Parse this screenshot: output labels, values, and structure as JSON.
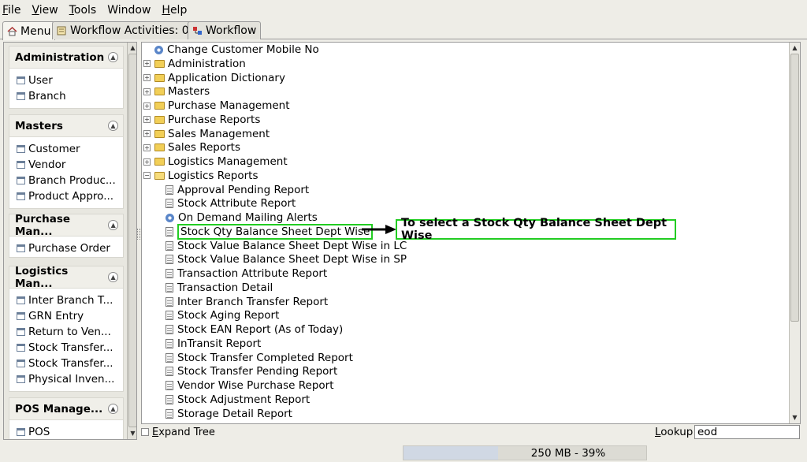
{
  "menubar": {
    "items": [
      {
        "first": "F",
        "rest": "ile"
      },
      {
        "first": "V",
        "rest": "iew"
      },
      {
        "first": "T",
        "rest": "ools"
      },
      {
        "first": "",
        "rest": "Window"
      },
      {
        "first": "H",
        "rest": "elp"
      }
    ]
  },
  "tabs": {
    "menu": "Menu",
    "workflow_activities": "Workflow Activities: 0",
    "workflow": "Workflow"
  },
  "sidebar": {
    "sections": [
      {
        "title": "Administration",
        "items": [
          "User",
          "Branch"
        ]
      },
      {
        "title": "Masters",
        "items": [
          "Customer",
          "Vendor",
          "Branch Produc...",
          "Product Appro..."
        ]
      },
      {
        "title": "Purchase Man...",
        "items": [
          "Purchase Order"
        ]
      },
      {
        "title": "Logistics Man...",
        "items": [
          "Inter Branch T...",
          "GRN Entry",
          "Return to Ven...",
          "Stock Transfer...",
          "Stock Transfer...",
          "Physical Inven..."
        ]
      },
      {
        "title": "POS Manage...",
        "items": [
          "POS"
        ]
      }
    ]
  },
  "tree": {
    "top_item": "Change Customer Mobile No",
    "folders": [
      "Administration",
      "Application Dictionary",
      "Masters",
      "Purchase Management",
      "Purchase Reports",
      "Sales Management",
      "Sales Reports",
      "Logistics Management"
    ],
    "open_folder": "Logistics Reports",
    "reports": [
      {
        "label": "Approval Pending Report",
        "icon": "doc"
      },
      {
        "label": "Stock Attribute Report",
        "icon": "doc"
      },
      {
        "label": "On Demand Mailing Alerts",
        "icon": "gear"
      },
      {
        "label": "Stock Qty Balance Sheet Dept Wise",
        "icon": "doc",
        "highlight": true
      },
      {
        "label": "Stock Value Balance Sheet Dept Wise in LC",
        "icon": "doc"
      },
      {
        "label": "Stock Value Balance Sheet Dept Wise in SP",
        "icon": "doc"
      },
      {
        "label": "Transaction Attribute Report",
        "icon": "doc"
      },
      {
        "label": "Transaction Detail",
        "icon": "doc"
      },
      {
        "label": "Inter Branch Transfer Report",
        "icon": "doc"
      },
      {
        "label": "Stock Aging Report",
        "icon": "doc"
      },
      {
        "label": "Stock EAN Report (As of Today)",
        "icon": "doc"
      },
      {
        "label": "InTransit Report",
        "icon": "doc"
      },
      {
        "label": "Stock Transfer Completed Report",
        "icon": "doc"
      },
      {
        "label": "Stock Transfer Pending Report",
        "icon": "doc"
      },
      {
        "label": "Vendor Wise Purchase Report",
        "icon": "doc"
      },
      {
        "label": "Stock Adjustment Report",
        "icon": "doc"
      },
      {
        "label": "Storage Detail Report",
        "icon": "doc"
      }
    ]
  },
  "annotation": {
    "text": "To select a Stock Qty Balance Sheet Dept Wise",
    "color": "#22cc22"
  },
  "bottom": {
    "expand_tree_first": "E",
    "expand_tree_rest": "xpand Tree",
    "lookup_first": "L",
    "lookup_rest": "ookup",
    "lookup_value": "eod"
  },
  "status": {
    "memory_text": "250 MB - 39%",
    "memory_fraction": 0.39
  }
}
